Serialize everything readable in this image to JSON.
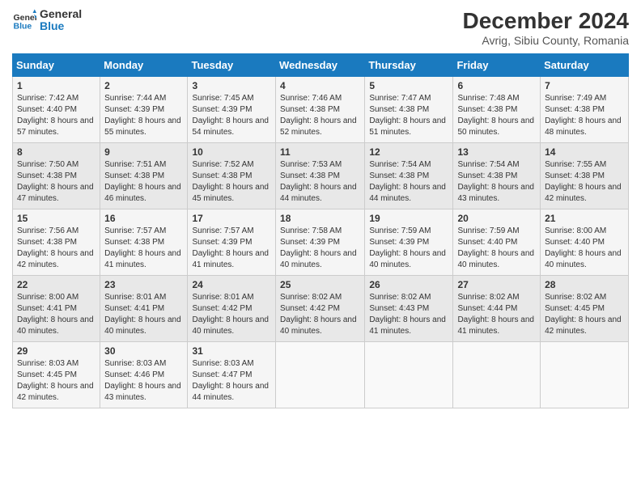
{
  "header": {
    "logo_line1": "General",
    "logo_line2": "Blue",
    "main_title": "December 2024",
    "subtitle": "Avrig, Sibiu County, Romania"
  },
  "calendar": {
    "headers": [
      "Sunday",
      "Monday",
      "Tuesday",
      "Wednesday",
      "Thursday",
      "Friday",
      "Saturday"
    ],
    "weeks": [
      [
        null,
        null,
        null,
        null,
        null,
        null,
        null
      ]
    ],
    "days": {
      "1": {
        "sunrise": "7:42 AM",
        "sunset": "4:40 PM",
        "daylight": "8 hours and 57 minutes."
      },
      "2": {
        "sunrise": "7:44 AM",
        "sunset": "4:39 PM",
        "daylight": "8 hours and 55 minutes."
      },
      "3": {
        "sunrise": "7:45 AM",
        "sunset": "4:39 PM",
        "daylight": "8 hours and 54 minutes."
      },
      "4": {
        "sunrise": "7:46 AM",
        "sunset": "4:38 PM",
        "daylight": "8 hours and 52 minutes."
      },
      "5": {
        "sunrise": "7:47 AM",
        "sunset": "4:38 PM",
        "daylight": "8 hours and 51 minutes."
      },
      "6": {
        "sunrise": "7:48 AM",
        "sunset": "4:38 PM",
        "daylight": "8 hours and 50 minutes."
      },
      "7": {
        "sunrise": "7:49 AM",
        "sunset": "4:38 PM",
        "daylight": "8 hours and 48 minutes."
      },
      "8": {
        "sunrise": "7:50 AM",
        "sunset": "4:38 PM",
        "daylight": "8 hours and 47 minutes."
      },
      "9": {
        "sunrise": "7:51 AM",
        "sunset": "4:38 PM",
        "daylight": "8 hours and 46 minutes."
      },
      "10": {
        "sunrise": "7:52 AM",
        "sunset": "4:38 PM",
        "daylight": "8 hours and 45 minutes."
      },
      "11": {
        "sunrise": "7:53 AM",
        "sunset": "4:38 PM",
        "daylight": "8 hours and 44 minutes."
      },
      "12": {
        "sunrise": "7:54 AM",
        "sunset": "4:38 PM",
        "daylight": "8 hours and 44 minutes."
      },
      "13": {
        "sunrise": "7:54 AM",
        "sunset": "4:38 PM",
        "daylight": "8 hours and 43 minutes."
      },
      "14": {
        "sunrise": "7:55 AM",
        "sunset": "4:38 PM",
        "daylight": "8 hours and 42 minutes."
      },
      "15": {
        "sunrise": "7:56 AM",
        "sunset": "4:38 PM",
        "daylight": "8 hours and 42 minutes."
      },
      "16": {
        "sunrise": "7:57 AM",
        "sunset": "4:38 PM",
        "daylight": "8 hours and 41 minutes."
      },
      "17": {
        "sunrise": "7:57 AM",
        "sunset": "4:39 PM",
        "daylight": "8 hours and 41 minutes."
      },
      "18": {
        "sunrise": "7:58 AM",
        "sunset": "4:39 PM",
        "daylight": "8 hours and 40 minutes."
      },
      "19": {
        "sunrise": "7:59 AM",
        "sunset": "4:39 PM",
        "daylight": "8 hours and 40 minutes."
      },
      "20": {
        "sunrise": "7:59 AM",
        "sunset": "4:40 PM",
        "daylight": "8 hours and 40 minutes."
      },
      "21": {
        "sunrise": "8:00 AM",
        "sunset": "4:40 PM",
        "daylight": "8 hours and 40 minutes."
      },
      "22": {
        "sunrise": "8:00 AM",
        "sunset": "4:41 PM",
        "daylight": "8 hours and 40 minutes."
      },
      "23": {
        "sunrise": "8:01 AM",
        "sunset": "4:41 PM",
        "daylight": "8 hours and 40 minutes."
      },
      "24": {
        "sunrise": "8:01 AM",
        "sunset": "4:42 PM",
        "daylight": "8 hours and 40 minutes."
      },
      "25": {
        "sunrise": "8:02 AM",
        "sunset": "4:42 PM",
        "daylight": "8 hours and 40 minutes."
      },
      "26": {
        "sunrise": "8:02 AM",
        "sunset": "4:43 PM",
        "daylight": "8 hours and 41 minutes."
      },
      "27": {
        "sunrise": "8:02 AM",
        "sunset": "4:44 PM",
        "daylight": "8 hours and 41 minutes."
      },
      "28": {
        "sunrise": "8:02 AM",
        "sunset": "4:45 PM",
        "daylight": "8 hours and 42 minutes."
      },
      "29": {
        "sunrise": "8:03 AM",
        "sunset": "4:45 PM",
        "daylight": "8 hours and 42 minutes."
      },
      "30": {
        "sunrise": "8:03 AM",
        "sunset": "4:46 PM",
        "daylight": "8 hours and 43 minutes."
      },
      "31": {
        "sunrise": "8:03 AM",
        "sunset": "4:47 PM",
        "daylight": "8 hours and 44 minutes."
      }
    }
  }
}
